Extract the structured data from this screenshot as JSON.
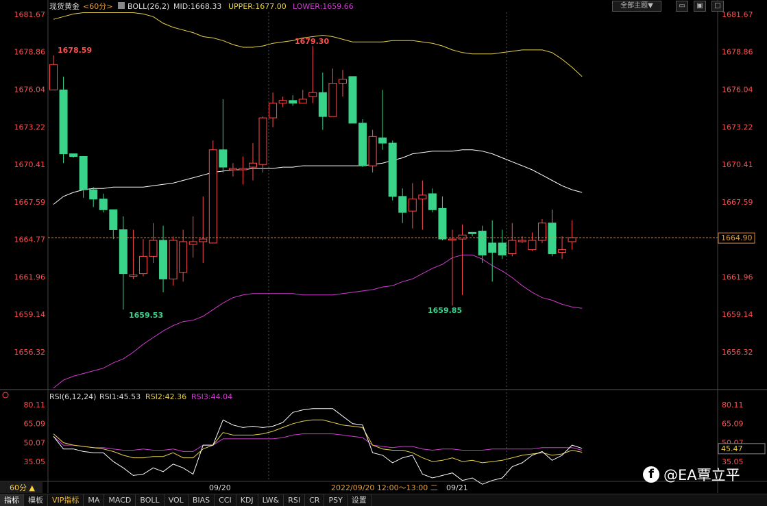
{
  "header": {
    "symbol": "现货黄金",
    "period": "<60分>",
    "indicator": "BOLL(26,2)",
    "mid": "MID:1668.33",
    "upper": "UPPER:1677.00",
    "lower": "LOWER:1659.66",
    "theme_button": "全部主题▼"
  },
  "price_axis_labels": [
    "1681.67",
    "1678.86",
    "1676.04",
    "1673.22",
    "1670.41",
    "1667.59",
    "1664.77",
    "1661.96",
    "1659.14",
    "1656.32"
  ],
  "price_axis_values": [
    1681.67,
    1678.86,
    1676.04,
    1673.22,
    1670.41,
    1667.59,
    1664.77,
    1661.96,
    1659.14,
    1656.32
  ],
  "current_price": "1664.90",
  "current_price_value": 1664.9,
  "annotations": {
    "high_left": "1678.59",
    "high_mid": "1679.30",
    "low_left": "1659.53",
    "low_right": "1659.85"
  },
  "rsi": {
    "title": "RSI(6,12,24)",
    "rsi1": "RSI1:45.53",
    "rsi2": "RSI2:42.36",
    "rsi3": "RSI3:44.04",
    "axis_labels": [
      "80.11",
      "65.09",
      "50.07",
      "35.05"
    ],
    "axis_values": [
      80.11,
      65.09,
      50.07,
      35.05
    ],
    "current": "45.47",
    "current_value": 45.47
  },
  "time_axis": {
    "period_selector": "60分 ▲",
    "date1": "09/20",
    "crosshair_label": "2022/09/20 12:00～13:00 二",
    "date2": "09/21"
  },
  "tabs": [
    "指标",
    "模板",
    "VIP指标",
    "MA",
    "MACD",
    "BOLL",
    "VOL",
    "BIAS",
    "CCI",
    "KDJ",
    "LW&",
    "RSI",
    "CR",
    "PSY",
    "设置"
  ],
  "watermark": "@EA覃立平",
  "colors": {
    "up": "#ff4d4d",
    "down": "#3ad38a",
    "upper": "#e6d24a",
    "mid": "#ffffff",
    "lower": "#d03cd0",
    "axis_text": "#ff5050"
  },
  "chart_data": {
    "type": "candlestick",
    "title": "现货黄金 <60分>",
    "ylim": [
      1653.5,
      1682.5
    ],
    "candles": [
      {
        "o": 1676.0,
        "h": 1678.6,
        "l": 1676.0,
        "c": 1677.9
      },
      {
        "o": 1676.0,
        "h": 1677.0,
        "l": 1670.5,
        "c": 1671.2
      },
      {
        "o": 1671.2,
        "h": 1671.2,
        "l": 1670.9,
        "c": 1671.0
      },
      {
        "o": 1671.0,
        "h": 1671.0,
        "l": 1667.9,
        "c": 1668.5
      },
      {
        "o": 1668.5,
        "h": 1668.7,
        "l": 1667.2,
        "c": 1667.8
      },
      {
        "o": 1667.8,
        "h": 1668.2,
        "l": 1666.8,
        "c": 1667.0
      },
      {
        "o": 1667.0,
        "h": 1667.0,
        "l": 1664.8,
        "c": 1665.5
      },
      {
        "o": 1665.5,
        "h": 1666.5,
        "l": 1659.5,
        "c": 1662.2
      },
      {
        "o": 1662.0,
        "h": 1665.5,
        "l": 1661.8,
        "c": 1662.1
      },
      {
        "o": 1662.2,
        "h": 1664.8,
        "l": 1662.0,
        "c": 1663.5
      },
      {
        "o": 1663.5,
        "h": 1666.0,
        "l": 1663.0,
        "c": 1664.7
      },
      {
        "o": 1664.7,
        "h": 1665.8,
        "l": 1660.8,
        "c": 1661.8
      },
      {
        "o": 1661.8,
        "h": 1665.0,
        "l": 1661.3,
        "c": 1664.7
      },
      {
        "o": 1662.3,
        "h": 1665.5,
        "l": 1661.6,
        "c": 1664.6
      },
      {
        "o": 1664.4,
        "h": 1666.5,
        "l": 1663.4,
        "c": 1664.6
      },
      {
        "o": 1664.6,
        "h": 1668.0,
        "l": 1663.0,
        "c": 1664.8
      },
      {
        "o": 1664.5,
        "h": 1672.2,
        "l": 1664.5,
        "c": 1671.5
      },
      {
        "o": 1671.5,
        "h": 1675.3,
        "l": 1669.8,
        "c": 1670.2
      },
      {
        "o": 1670.0,
        "h": 1670.5,
        "l": 1669.5,
        "c": 1670.1
      },
      {
        "o": 1670.0,
        "h": 1671.0,
        "l": 1668.9,
        "c": 1670.1
      },
      {
        "o": 1670.2,
        "h": 1672.0,
        "l": 1669.2,
        "c": 1670.5
      },
      {
        "o": 1670.4,
        "h": 1674.0,
        "l": 1669.8,
        "c": 1673.9
      },
      {
        "o": 1673.9,
        "h": 1675.8,
        "l": 1673.2,
        "c": 1675.0
      },
      {
        "o": 1675.0,
        "h": 1675.5,
        "l": 1674.7,
        "c": 1675.2
      },
      {
        "o": 1675.2,
        "h": 1675.6,
        "l": 1674.8,
        "c": 1675.0
      },
      {
        "o": 1675.0,
        "h": 1676.0,
        "l": 1675.0,
        "c": 1675.3
      },
      {
        "o": 1675.5,
        "h": 1679.3,
        "l": 1675.0,
        "c": 1675.8
      },
      {
        "o": 1675.8,
        "h": 1677.3,
        "l": 1673.0,
        "c": 1674.0
      },
      {
        "o": 1674.0,
        "h": 1677.6,
        "l": 1674.0,
        "c": 1676.5
      },
      {
        "o": 1676.5,
        "h": 1677.5,
        "l": 1675.5,
        "c": 1676.8
      },
      {
        "o": 1677.0,
        "h": 1677.0,
        "l": 1673.5,
        "c": 1673.5
      },
      {
        "o": 1673.5,
        "h": 1673.8,
        "l": 1670.2,
        "c": 1670.3
      },
      {
        "o": 1670.3,
        "h": 1673.0,
        "l": 1669.8,
        "c": 1672.5
      },
      {
        "o": 1672.4,
        "h": 1676.0,
        "l": 1671.5,
        "c": 1672.0
      },
      {
        "o": 1672.0,
        "h": 1672.2,
        "l": 1667.7,
        "c": 1668.0
      },
      {
        "o": 1668.0,
        "h": 1668.6,
        "l": 1666.0,
        "c": 1666.8
      },
      {
        "o": 1666.9,
        "h": 1669.0,
        "l": 1665.6,
        "c": 1667.8
      },
      {
        "o": 1667.8,
        "h": 1669.2,
        "l": 1665.5,
        "c": 1668.1
      },
      {
        "o": 1668.2,
        "h": 1668.6,
        "l": 1666.8,
        "c": 1667.0
      },
      {
        "o": 1667.1,
        "h": 1668.0,
        "l": 1664.7,
        "c": 1664.8
      },
      {
        "o": 1664.8,
        "h": 1665.5,
        "l": 1659.8,
        "c": 1664.8
      },
      {
        "o": 1664.8,
        "h": 1665.9,
        "l": 1660.6,
        "c": 1665.1
      },
      {
        "o": 1665.3,
        "h": 1665.3,
        "l": 1665.0,
        "c": 1665.2
      },
      {
        "o": 1665.4,
        "h": 1665.8,
        "l": 1663.0,
        "c": 1663.6
      },
      {
        "o": 1664.5,
        "h": 1666.2,
        "l": 1661.6,
        "c": 1663.8
      },
      {
        "o": 1664.5,
        "h": 1665.5,
        "l": 1663.3,
        "c": 1663.6
      },
      {
        "o": 1663.7,
        "h": 1666.0,
        "l": 1663.5,
        "c": 1664.7
      },
      {
        "o": 1664.6,
        "h": 1665.0,
        "l": 1664.5,
        "c": 1664.7
      },
      {
        "o": 1664.0,
        "h": 1665.3,
        "l": 1663.9,
        "c": 1664.7
      },
      {
        "o": 1664.7,
        "h": 1666.3,
        "l": 1664.5,
        "c": 1666.0
      },
      {
        "o": 1666.0,
        "h": 1667.0,
        "l": 1663.5,
        "c": 1663.7
      },
      {
        "o": 1663.8,
        "h": 1665.0,
        "l": 1663.3,
        "c": 1664.0
      },
      {
        "o": 1664.6,
        "h": 1666.2,
        "l": 1664.0,
        "c": 1664.9
      }
    ],
    "boll_upper": [
      1681.3,
      1681.5,
      1681.7,
      1681.8,
      1681.8,
      1681.8,
      1681.8,
      1681.8,
      1681.8,
      1681.7,
      1681.5,
      1681.0,
      1680.7,
      1680.5,
      1680.3,
      1680.0,
      1679.9,
      1679.7,
      1679.4,
      1679.2,
      1679.2,
      1679.3,
      1679.5,
      1679.6,
      1679.7,
      1679.9,
      1680.0,
      1680.1,
      1680.0,
      1679.8,
      1679.6,
      1679.6,
      1679.6,
      1679.6,
      1679.7,
      1679.7,
      1679.7,
      1679.6,
      1679.5,
      1679.3,
      1679.0,
      1678.8,
      1678.7,
      1678.7,
      1678.7,
      1678.8,
      1678.9,
      1679.0,
      1679.0,
      1679.0,
      1678.8,
      1678.3,
      1677.7,
      1677.0
    ],
    "boll_mid": [
      1667.4,
      1668.0,
      1668.3,
      1668.5,
      1668.6,
      1668.6,
      1668.7,
      1668.7,
      1668.7,
      1668.7,
      1668.8,
      1668.9,
      1669.0,
      1669.2,
      1669.4,
      1669.6,
      1669.8,
      1669.9,
      1670.0,
      1670.0,
      1670.1,
      1670.1,
      1670.1,
      1670.2,
      1670.2,
      1670.3,
      1670.3,
      1670.3,
      1670.3,
      1670.3,
      1670.3,
      1670.3,
      1670.4,
      1670.5,
      1670.7,
      1670.9,
      1671.2,
      1671.3,
      1671.4,
      1671.4,
      1671.4,
      1671.5,
      1671.5,
      1671.4,
      1671.2,
      1670.9,
      1670.6,
      1670.3,
      1670.0,
      1669.6,
      1669.2,
      1668.8,
      1668.5,
      1668.3
    ],
    "boll_lower": [
      1653.6,
      1654.2,
      1654.5,
      1654.7,
      1654.9,
      1655.1,
      1655.5,
      1655.8,
      1656.3,
      1656.9,
      1657.4,
      1657.9,
      1658.3,
      1658.6,
      1658.7,
      1659.0,
      1659.5,
      1660.0,
      1660.4,
      1660.6,
      1660.7,
      1660.7,
      1660.7,
      1660.7,
      1660.7,
      1660.6,
      1660.6,
      1660.6,
      1660.6,
      1660.7,
      1660.8,
      1660.9,
      1661.0,
      1661.2,
      1661.3,
      1661.6,
      1661.8,
      1662.2,
      1662.6,
      1662.9,
      1663.4,
      1663.6,
      1663.6,
      1663.3,
      1662.8,
      1662.4,
      1661.9,
      1661.3,
      1660.8,
      1660.4,
      1660.2,
      1659.9,
      1659.7,
      1659.6
    ]
  },
  "rsi_data": {
    "rsi1": [
      55,
      45,
      45,
      43,
      42,
      42,
      35,
      30,
      24,
      25,
      30,
      27,
      33,
      30,
      25,
      48,
      48,
      68,
      64,
      62,
      63,
      62,
      63,
      66,
      74,
      76,
      77,
      77,
      77,
      71,
      65,
      64,
      42,
      40,
      34,
      38,
      40,
      25,
      22,
      24,
      26,
      20,
      22,
      17,
      20,
      22,
      31,
      34,
      40,
      43,
      36,
      40,
      48,
      45.5
    ],
    "rsi2": [
      57,
      50,
      48,
      47,
      46,
      45,
      43,
      40,
      38,
      38,
      39,
      39,
      42,
      38,
      38,
      45,
      48,
      58,
      56,
      56,
      56,
      57,
      59,
      62,
      65,
      67,
      68,
      68,
      66,
      64,
      63,
      62,
      48,
      45,
      44,
      44,
      42,
      38,
      35,
      36,
      38,
      35,
      36,
      34,
      35,
      36,
      38,
      40,
      41,
      42,
      40,
      41,
      44,
      42.4
    ],
    "rsi3": [
      55,
      48,
      48,
      47,
      46,
      46,
      45,
      44,
      44,
      45,
      44,
      44,
      45,
      43,
      43,
      48,
      48,
      53,
      53,
      53,
      53,
      53,
      53,
      54,
      56,
      57,
      57,
      57,
      57,
      56,
      55,
      54,
      48,
      47,
      46,
      47,
      47,
      45,
      44,
      45,
      45,
      44,
      44,
      44,
      45,
      45,
      45,
      45,
      45,
      46,
      46,
      46,
      46,
      44.0
    ]
  }
}
